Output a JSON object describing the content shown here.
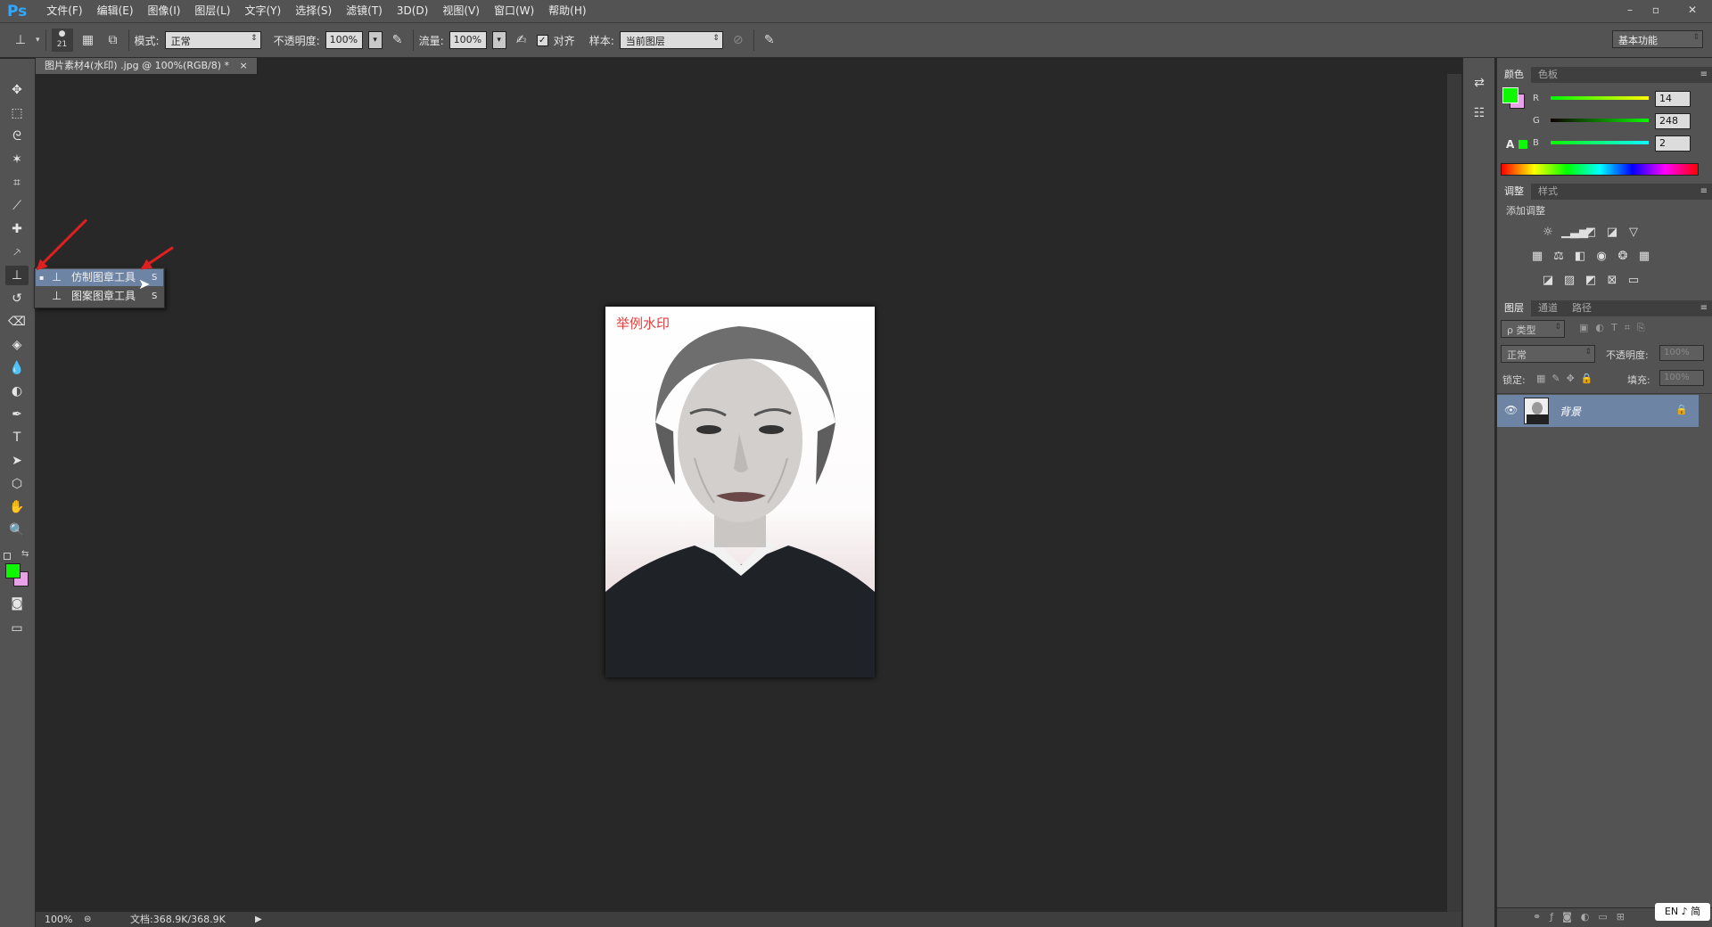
{
  "app": {
    "logo": "Ps"
  },
  "menu": [
    "文件(F)",
    "编辑(E)",
    "图像(I)",
    "图层(L)",
    "文字(Y)",
    "选择(S)",
    "滤镜(T)",
    "3D(D)",
    "视图(V)",
    "窗口(W)",
    "帮助(H)"
  ],
  "window_controls": {
    "minimize": "–",
    "restore": "▫",
    "close": "✕"
  },
  "options": {
    "brush_size": "21",
    "mode_label": "模式:",
    "mode_value": "正常",
    "opacity_label": "不透明度:",
    "opacity_value": "100%",
    "flow_label": "流量:",
    "flow_value": "100%",
    "align_label": "对齐",
    "align_checked": "✓",
    "sample_label": "样本:",
    "sample_value": "当前图层",
    "workspace": "基本功能"
  },
  "document": {
    "tab_title": "图片素材4(水印) .jpg @ 100%(RGB/8) *",
    "tab_close": "×",
    "watermark_text": "举例水印"
  },
  "flyout": {
    "items": [
      {
        "label": "仿制图章工具",
        "shortcut": "S"
      },
      {
        "label": "图案图章工具",
        "shortcut": "S"
      }
    ]
  },
  "status": {
    "zoom": "100%",
    "doc_size": "文档:368.9K/368.9K"
  },
  "color_panel": {
    "tabs": [
      "颜色",
      "色板"
    ],
    "r_label": "R",
    "r_value": "14",
    "g_label": "G",
    "g_value": "248",
    "b_label": "B",
    "b_value": "2",
    "foreground": "#0ef802",
    "background": "#e8a2e8"
  },
  "adjust_panel": {
    "tabs": [
      "调整",
      "样式"
    ],
    "heading": "添加调整"
  },
  "layers_panel": {
    "tabs": [
      "图层",
      "通道",
      "路径"
    ],
    "filter_label": "ρ 类型",
    "blend_mode": "正常",
    "opacity_label": "不透明度:",
    "opacity_value": "100%",
    "lock_label": "锁定:",
    "fill_label": "填充:",
    "fill_value": "100%",
    "layer_name": "背景"
  },
  "tray": {
    "ime": "EN ♪ 简"
  },
  "colors": {
    "accent": "#31a8ff",
    "selection": "#6d84a5",
    "arrow": "#e02020"
  }
}
